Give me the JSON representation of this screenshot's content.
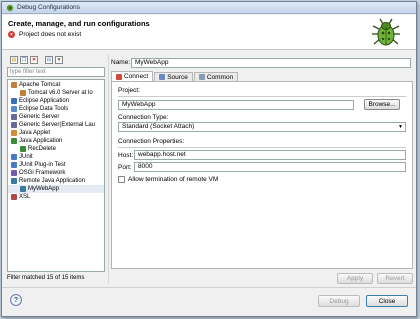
{
  "window": {
    "title": "Debug Configurations"
  },
  "header": {
    "title": "Create, manage, and run configurations",
    "message": "Project does not exist"
  },
  "filter": {
    "placeholder": "type filter text"
  },
  "tree": [
    {
      "label": "Apache Tomcat",
      "indent": 0,
      "color": "#c0803a"
    },
    {
      "label": "Tomcat v6.0 Server at lo",
      "indent": 1,
      "color": "#c0803a"
    },
    {
      "label": "Eclipse Application",
      "indent": 0,
      "color": "#3a6fc0"
    },
    {
      "label": "Eclipse Data Tools",
      "indent": 0,
      "color": "#5a8acb"
    },
    {
      "label": "Generic Server",
      "indent": 0,
      "color": "#6a6a9a"
    },
    {
      "label": "Generic Server(External Lau",
      "indent": 0,
      "color": "#6a6a9a"
    },
    {
      "label": "Java Applet",
      "indent": 0,
      "color": "#d18b3a"
    },
    {
      "label": "Java Application",
      "indent": 0,
      "color": "#3a8a3a"
    },
    {
      "label": "RecDelete",
      "indent": 1,
      "color": "#3a8a3a"
    },
    {
      "label": "JUnit",
      "indent": 0,
      "color": "#4a7acc"
    },
    {
      "label": "JUnit Plug-in Test",
      "indent": 0,
      "color": "#4a7acc"
    },
    {
      "label": "OSGi Framework",
      "indent": 0,
      "color": "#7a5ab0"
    },
    {
      "label": "Remote Java Application",
      "indent": 0,
      "color": "#3a7aa0"
    },
    {
      "label": "MyWebApp",
      "indent": 1,
      "color": "#3a7aa0",
      "selected": true
    },
    {
      "label": "XSL",
      "indent": 0,
      "color": "#b04a4a"
    }
  ],
  "filter_status": "Filter matched 15 of 15 items",
  "name": {
    "label": "Name:",
    "value": "MyWebApp"
  },
  "tabs": [
    "Connect",
    "Source",
    "Common"
  ],
  "connect": {
    "project_label": "Project:",
    "project_value": "MyWebApp",
    "browse_label": "Browse...",
    "conn_type_label": "Connection Type:",
    "conn_type_value": "Standard (Socket Attach)",
    "props_label": "Connection Properties:",
    "host_label": "Host:",
    "host_value": "webapp.host.net",
    "port_label": "Port:",
    "port_value": "8000",
    "allow_label": "Allow termination of remote VM"
  },
  "buttons": {
    "apply": "Apply",
    "revert": "Revert",
    "debug": "Debug",
    "close": "Close"
  }
}
